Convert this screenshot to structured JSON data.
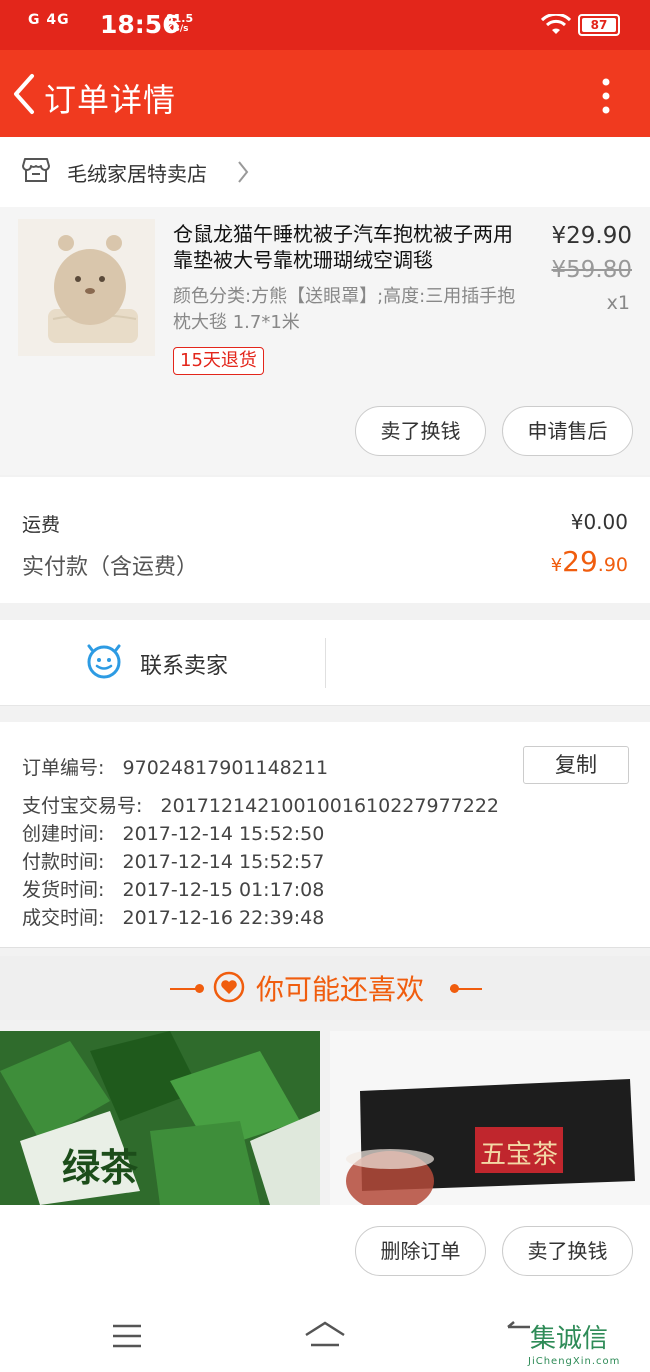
{
  "status_bar": {
    "signal": "G 4G",
    "time": "18:56",
    "speed_value": "81.5",
    "speed_unit": "KB/s",
    "battery": "87"
  },
  "header": {
    "title": "订单详情"
  },
  "shop": {
    "name": "毛绒家居特卖店"
  },
  "product": {
    "title": "仓鼠龙猫午睡枕被子汽车抱枕被子两用靠垫被大号靠枕珊瑚绒空调毯",
    "spec": "颜色分类:方熊【送眼罩】;高度:三用插手抱枕大毯 1.7*1米",
    "badge": "15天退货",
    "price": "¥29.90",
    "original_price": "¥59.80",
    "quantity": "x1",
    "btn_sell": "卖了换钱",
    "btn_aftersale": "申请售后"
  },
  "fees": {
    "shipping_label": "运费",
    "shipping_value": "¥0.00",
    "paid_label": "实付款（含运费）",
    "paid_currency": "¥",
    "paid_int": "29",
    "paid_dec": ".90"
  },
  "contact": {
    "label": "联系卖家"
  },
  "order_info": {
    "order_no_label": "订单编号:",
    "order_no": "97024817901148211",
    "copy_label": "复制",
    "alipay_label": "支付宝交易号:",
    "alipay_no": "2017121421001001610227977222",
    "created_label": "创建时间:",
    "created": "2017-12-14 15:52:50",
    "paid_label": "付款时间:",
    "paid": "2017-12-14 15:52:57",
    "shipped_label": "发货时间:",
    "shipped": "2017-12-15 01:17:08",
    "done_label": "成交时间:",
    "done": "2017-12-16 22:39:48"
  },
  "recommend": {
    "title": "你可能还喜欢",
    "item_left_text": "绿茶",
    "item_right_text": "五宝茶"
  },
  "actions": {
    "delete": "删除订单",
    "sell": "卖了换钱"
  },
  "watermark": {
    "text": "集诚信",
    "sub": "JiChengXin.com"
  },
  "colors": {
    "brand_red": "#e3261b",
    "accent_orange": "#f05d0e",
    "contact_blue": "#2d9be3"
  }
}
